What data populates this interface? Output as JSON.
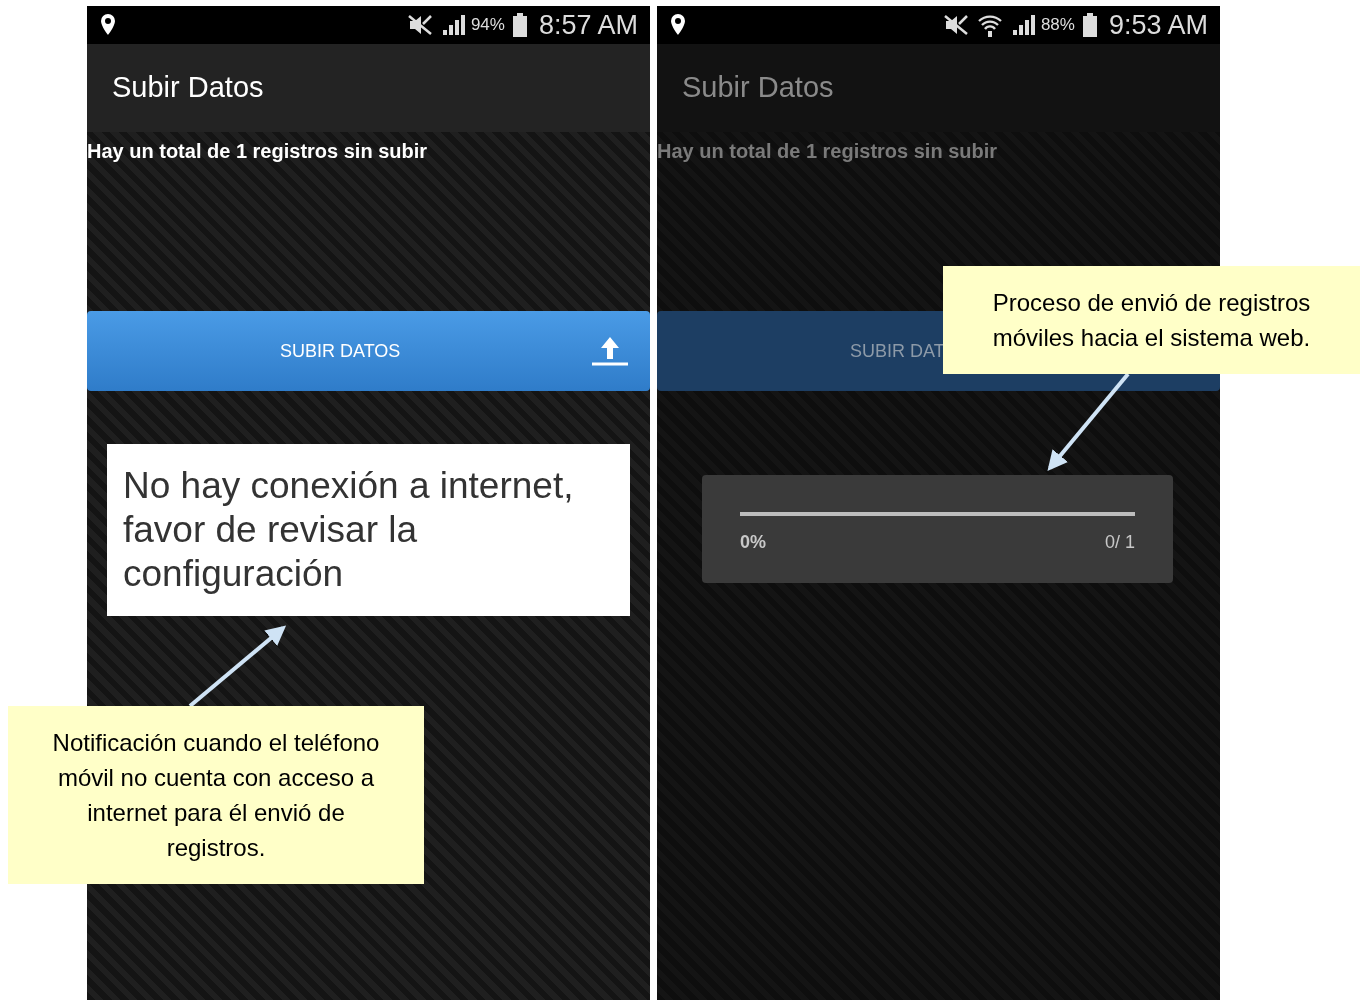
{
  "screens": [
    {
      "status_bar": {
        "battery": "94%",
        "time": "8:57 AM",
        "wifi": false
      },
      "title": "Subir Datos",
      "summary": "Hay un total de 1 registros sin subir",
      "upload_button": {
        "label": "SUBIR DATOS"
      },
      "dimmed": false,
      "toast": "No hay conexión a internet, favor de revisar la configuración"
    },
    {
      "status_bar": {
        "battery": "88%",
        "time": "9:53 AM",
        "wifi": true
      },
      "title": "Subir Datos",
      "summary": "Hay un total de 1 registros sin subir",
      "upload_button": {
        "label": "SUBIR DAT"
      },
      "dimmed": true,
      "progress_dialog": {
        "level": 0,
        "percent": "0%",
        "count": "0/ 1"
      }
    }
  ],
  "callouts": [
    {
      "text": "Notificación cuando el teléfono móvil no cuenta con acceso a internet para él envió de registros."
    },
    {
      "text": "Proceso de envió de registros móviles hacia el sistema web."
    }
  ]
}
